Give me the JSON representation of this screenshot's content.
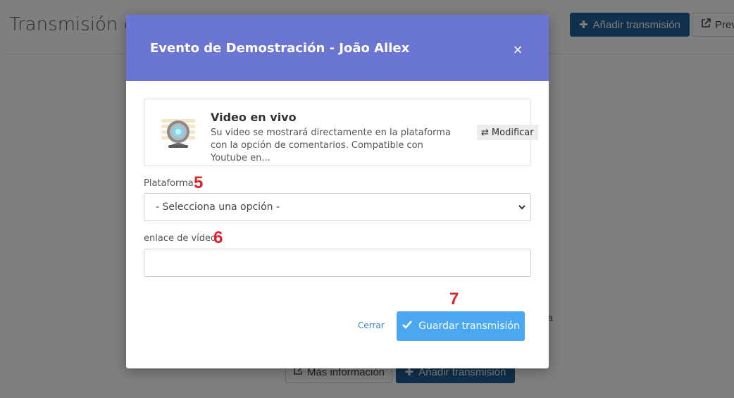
{
  "background": {
    "page_title": "Transmisión de",
    "add_button_label": "Añadir transmisión",
    "preview_button_label": "Prev",
    "more_info_label": "Más información",
    "add_button_bottom_label": "Añadir transmisión",
    "fragment_text": "a"
  },
  "modal": {
    "title": "Evento de Demostración - João Allex",
    "close_glyph": "×",
    "header_color": "#6b76d2",
    "card": {
      "title": "Video en vivo",
      "description": "Su video se mostrará directamente en la plataforma con la opción de comentarios. Compatible con Youtube en...",
      "modify_label": "Modificar",
      "icon": "webcam-icon"
    },
    "platform": {
      "label": "Plataforma",
      "marker": "5",
      "selected": "- Selecciona una opción -"
    },
    "video_link": {
      "label": "enlace de vídeo",
      "marker": "6",
      "value": ""
    },
    "footer": {
      "marker": "7",
      "close_label": "Cerrar",
      "save_label": "Guardar transmisión",
      "save_color": "#4aa7f0"
    }
  }
}
